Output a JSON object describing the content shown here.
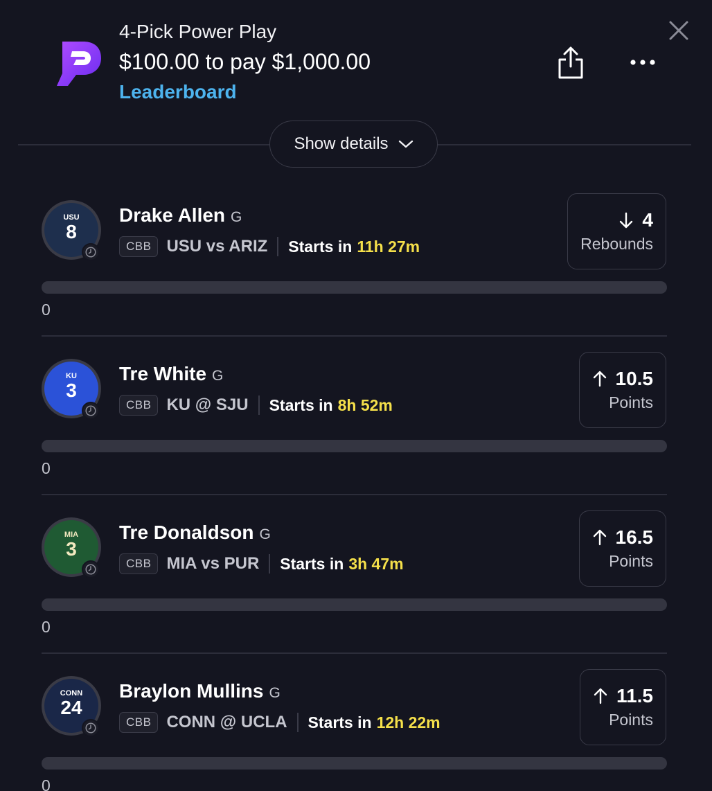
{
  "header": {
    "entry_type": "4-Pick Power Play",
    "stake_text": "$100.00 to pay $1,000.00",
    "leaderboard_label": "Leaderboard",
    "show_details_label": "Show details"
  },
  "colors": {
    "background": "#141520",
    "accent_link": "#4db3ee",
    "countdown": "#f5e04a",
    "logo_purple": "#7a3cff"
  },
  "icons": [
    "close-icon",
    "share-icon",
    "more-icon",
    "chevron-down-icon",
    "clock-icon",
    "arrow-down-icon",
    "arrow-up-icon"
  ],
  "picks": [
    {
      "name": "Drake Allen",
      "position": "G",
      "league": "CBB",
      "matchup": "USU vs ARIZ",
      "starts_label": "Starts in",
      "starts_time": "11h 27m",
      "direction": "down",
      "line": "4",
      "stat": "Rebounds",
      "progress_value": "0",
      "progress_fraction": 0,
      "jersey": {
        "team": "USU",
        "number": "8",
        "color": "#1e2f4d",
        "text": "#ffffff"
      }
    },
    {
      "name": "Tre White",
      "position": "G",
      "league": "CBB",
      "matchup": "KU @ SJU",
      "starts_label": "Starts in",
      "starts_time": "8h 52m",
      "direction": "up",
      "line": "10.5",
      "stat": "Points",
      "progress_value": "0",
      "progress_fraction": 0,
      "jersey": {
        "team": "KU",
        "number": "3",
        "color": "#2b52d8",
        "text": "#ffffff"
      }
    },
    {
      "name": "Tre Donaldson",
      "position": "G",
      "league": "CBB",
      "matchup": "MIA vs PUR",
      "starts_label": "Starts in",
      "starts_time": "3h 47m",
      "direction": "up",
      "line": "16.5",
      "stat": "Points",
      "progress_value": "0",
      "progress_fraction": 0,
      "jersey": {
        "team": "MIA",
        "number": "3",
        "color": "#1f5a33",
        "text": "#f3e9c0"
      }
    },
    {
      "name": "Braylon Mullins",
      "position": "G",
      "league": "CBB",
      "matchup": "CONN @ UCLA",
      "starts_label": "Starts in",
      "starts_time": "12h 22m",
      "direction": "up",
      "line": "11.5",
      "stat": "Points",
      "progress_value": "0",
      "progress_fraction": 0,
      "jersey": {
        "team": "CONN",
        "number": "24",
        "color": "#1a2748",
        "text": "#ffffff"
      }
    }
  ]
}
